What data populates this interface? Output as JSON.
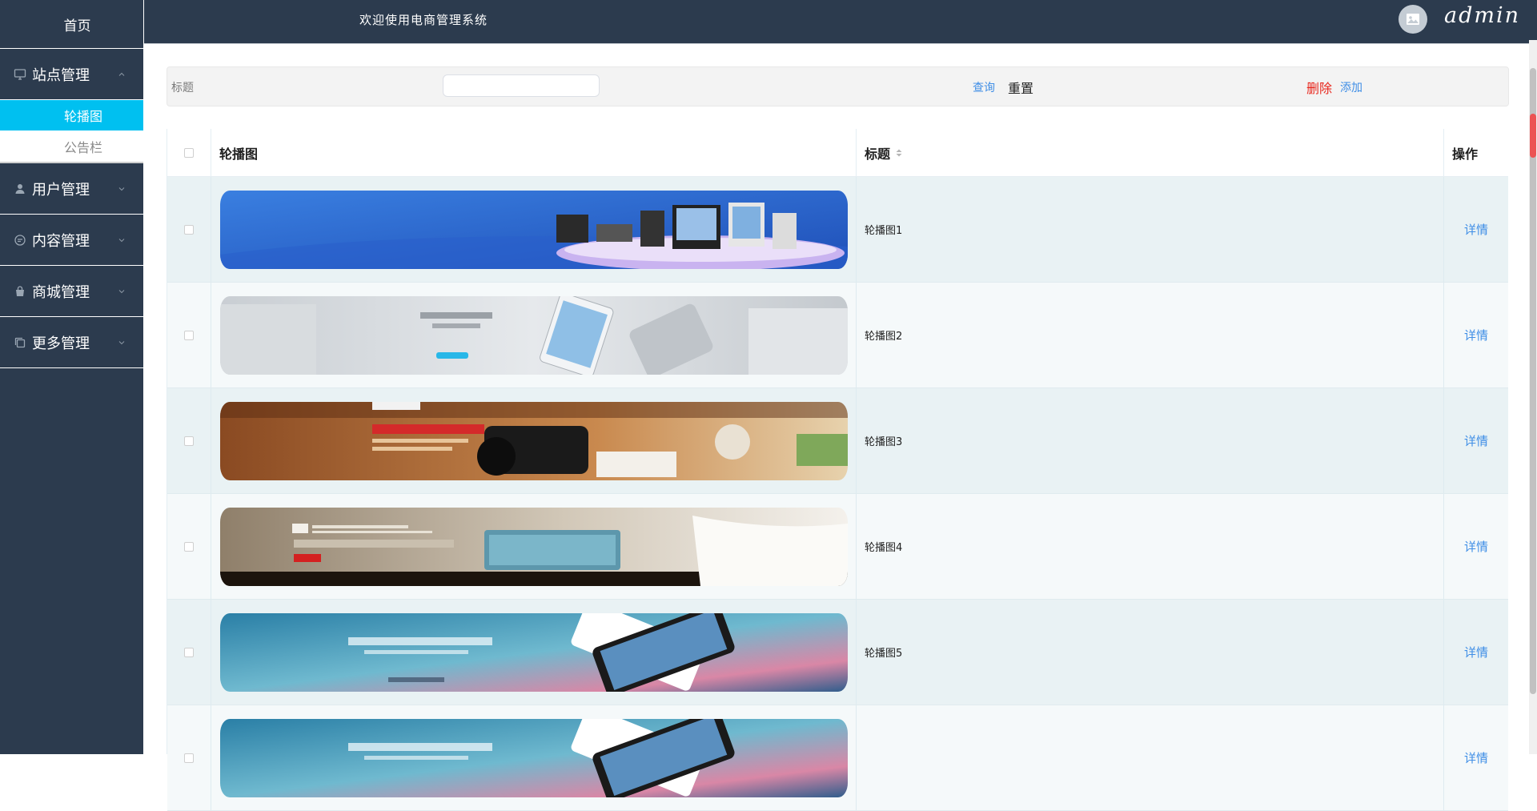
{
  "sidebar": {
    "home": "首页",
    "groups": [
      {
        "label": "站点管理",
        "icon": "monitor-icon",
        "expanded": true,
        "items": [
          {
            "label": "轮播图",
            "active": true
          },
          {
            "label": "公告栏",
            "active": false
          }
        ]
      },
      {
        "label": "用户管理",
        "icon": "user-icon",
        "expanded": false
      },
      {
        "label": "内容管理",
        "icon": "chat-icon",
        "expanded": false
      },
      {
        "label": "商城管理",
        "icon": "bag-icon",
        "expanded": false
      },
      {
        "label": "更多管理",
        "icon": "copy-icon",
        "expanded": false
      }
    ]
  },
  "header": {
    "welcome": "欢迎使用电商管理系统",
    "avatar_icon": "image-icon",
    "username": "admin"
  },
  "filter": {
    "title_label": "标题",
    "title_value": "",
    "query_label": "查询",
    "reset_label": "重置",
    "delete_label": "删除",
    "add_label": "添加"
  },
  "table": {
    "columns": {
      "image": "轮播图",
      "title": "标题",
      "action": "操作"
    },
    "rows": [
      {
        "title": "轮播图1",
        "action": "详情",
        "banner": "electronics-banner"
      },
      {
        "title": "轮播图2",
        "action": "详情",
        "banner": "phone-silver-banner"
      },
      {
        "title": "轮播图3",
        "action": "详情",
        "banner": "camera-banner"
      },
      {
        "title": "轮播图4",
        "action": "详情",
        "banner": "speaker-banner"
      },
      {
        "title": "轮播图5",
        "action": "详情",
        "banner": "mi-note-banner"
      },
      {
        "title": "",
        "action": "详情",
        "banner": "mi-note-banner"
      }
    ]
  },
  "colors": {
    "sidebar_bg": "#2c3b4e",
    "active_item": "#00c0f0",
    "link": "#3f8ee6",
    "delete": "#e8261c"
  }
}
